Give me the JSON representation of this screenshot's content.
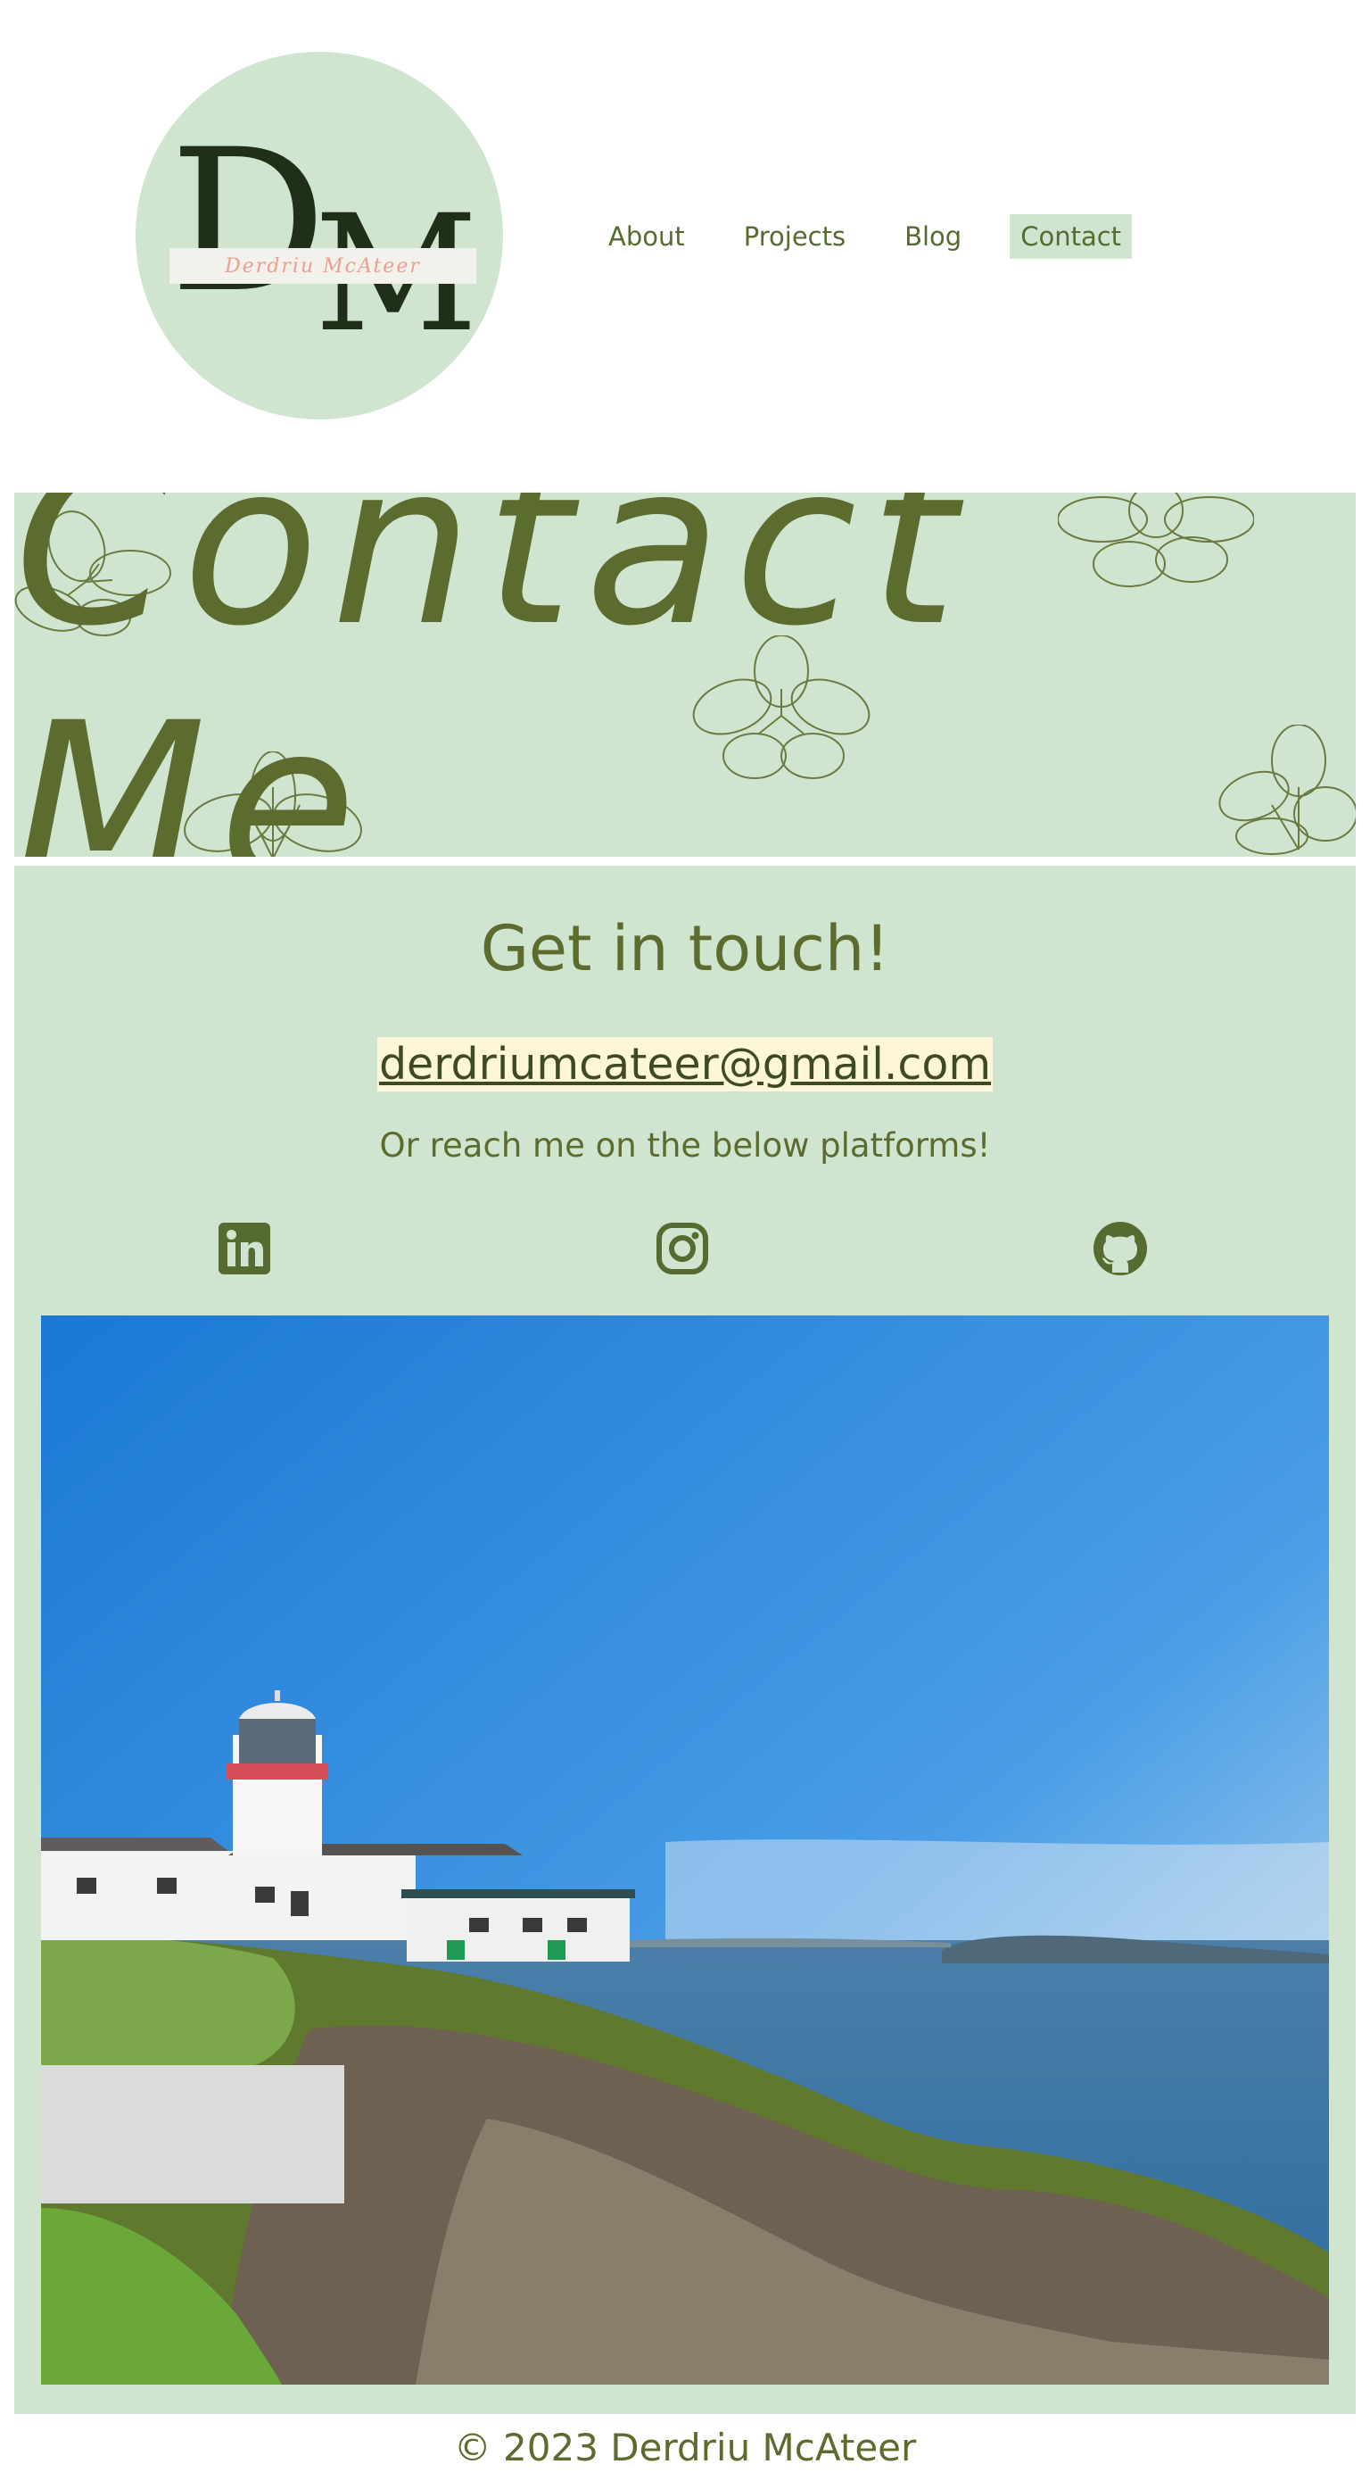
{
  "logo": {
    "monogram_d": "D",
    "monogram_m": "M",
    "script_name": "Derdriu McAteer"
  },
  "nav": {
    "items": [
      "About",
      "Projects",
      "Blog",
      "Contact"
    ],
    "active": "Contact"
  },
  "banner": {
    "title": "Contact Me"
  },
  "contact": {
    "heading": "Get in touch!",
    "email": "derdriumcateer@gmail.com",
    "subtext": "Or reach me on the below platforms!",
    "social_icons": [
      "linkedin-icon",
      "instagram-icon",
      "github-icon"
    ]
  },
  "footer": {
    "text": "© 2023 Derdriu McAteer"
  },
  "colors": {
    "accent_green": "#cfe5cf",
    "text_olive": "#5c6b2e",
    "email_highlight": "#fdf6d8"
  }
}
